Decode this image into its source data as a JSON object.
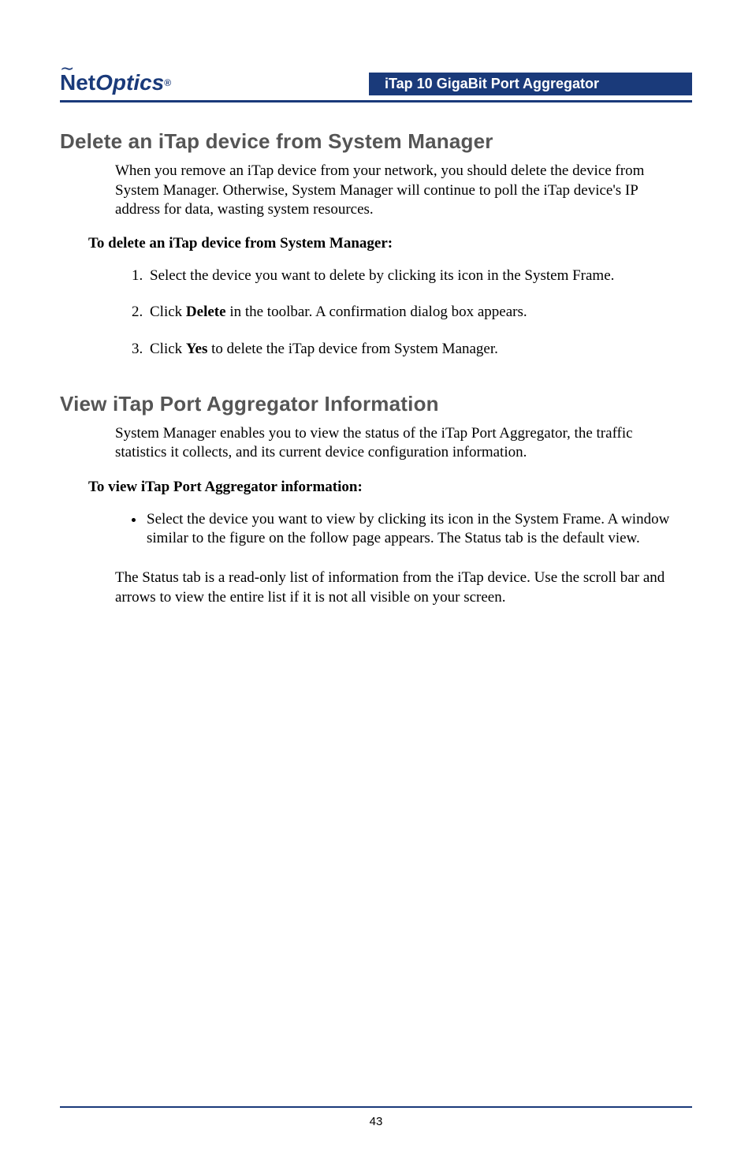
{
  "header": {
    "logo_net": "Net",
    "logo_optics": "Optics",
    "logo_reg": "®",
    "title_bar": "iTap 10 GigaBit Port Aggregator"
  },
  "section1": {
    "heading": "Delete an iTap device from System Manager",
    "intro": "When you remove an iTap device from your network, you should delete the device from System Manager. Otherwise, System Manager will continue to poll the iTap device's IP address for data, wasting system resources.",
    "subhead": "To delete an iTap device from System Manager:",
    "steps": [
      "Select the device you want to delete by clicking its icon in the System Frame.",
      {
        "pre": "Click ",
        "bold": "Delete",
        "post": " in the toolbar. A confirmation dialog box appears."
      },
      {
        "pre": "Click ",
        "bold": "Yes",
        "post": " to delete the iTap device from System Manager."
      }
    ]
  },
  "section2": {
    "heading": "View iTap Port Aggregator Information",
    "intro": "System Manager enables you to view the status of the iTap Port Aggregator, the traffic statistics it collects, and its current device configuration information.",
    "subhead": "To view iTap Port Aggregator information:",
    "bullet": "Select the device you want to view by clicking its icon in the System Frame. A window similar to the figure on the follow page appears. The Status tab is the default view.",
    "closing": "The Status tab is a read-only list of information from the iTap device. Use the scroll bar and arrows to view the entire list if it is not all visible on your screen."
  },
  "footer": {
    "page_number": "43"
  }
}
